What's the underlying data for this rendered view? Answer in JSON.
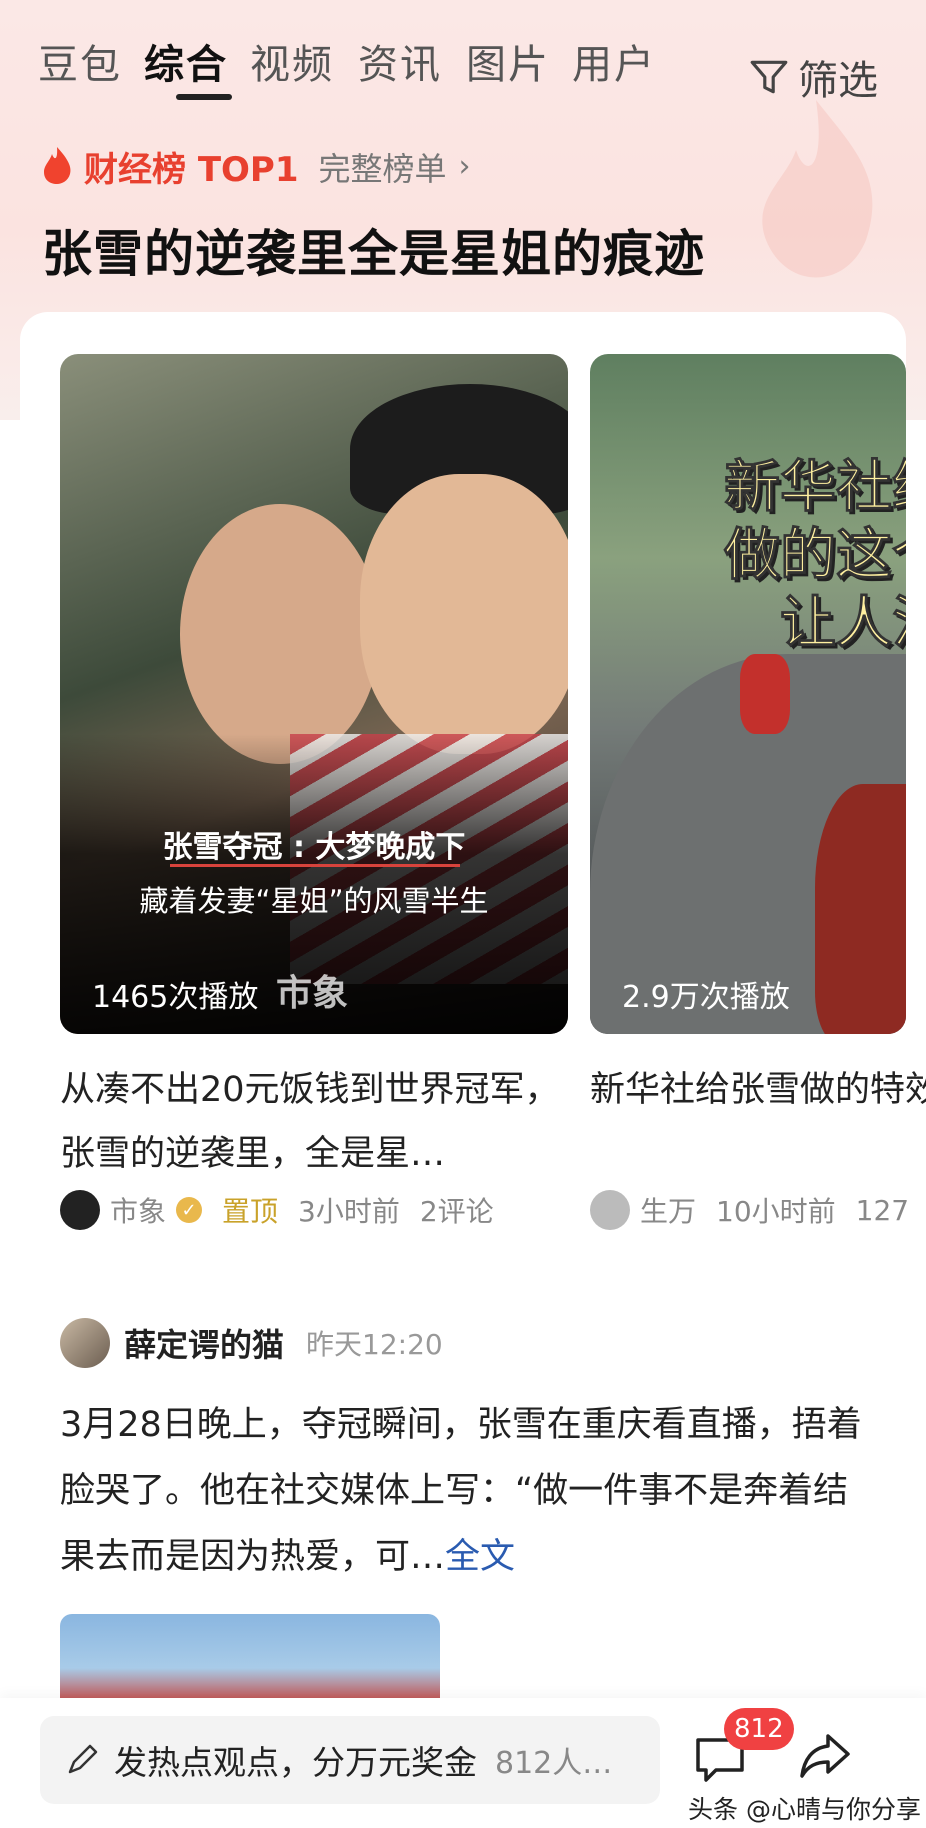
{
  "tabs": {
    "items": [
      "豆包",
      "综合",
      "视频",
      "资讯",
      "图片",
      "用户"
    ],
    "active": "综合",
    "filter_label": "筛选"
  },
  "hot": {
    "rank_label": "财经榜 TOP1",
    "full_list_label": "完整榜单",
    "headline": "张雪的逆袭里全是星姐的痕迹"
  },
  "videos": [
    {
      "caption_line1": "张雪夺冠 : 大梦晚成下",
      "caption_line2": "藏着发妻“星姐”的风雪半生",
      "plays": "1465次播放",
      "watermark": "市象",
      "title": "从凑不出20元饭钱到世界冠军，张雪的逆袭里，全是星…",
      "source": "市象",
      "pinned": "置顶",
      "time": "3小时前",
      "comments": "2评论"
    },
    {
      "overlay_title": "新华社给\n做的这个\n让人泪",
      "plays": "2.9万次播放",
      "title": "新华社给张雪做的特效让人类泪了了",
      "source": "生万",
      "time": "10小时前",
      "extra": "127"
    }
  ],
  "post": {
    "author": "薛定谔的猫",
    "time": "昨天12:20",
    "body": "3月28日晚上，夺冠瞬间，张雪在重庆看直播，捂着脸哭了。他在社交媒体上写：“做一件事不是奔着结果去而是因为热爱，可…",
    "more_label": "全文"
  },
  "bottom": {
    "compose_label": "发热点观点，分万元奖金",
    "compose_count": "812人…",
    "comment_badge": "812",
    "watermark": "头条 @心晴与你分享"
  },
  "colors": {
    "accent_red": "#e8402f",
    "link_blue": "#2a5bb0",
    "pin_gold": "#c9a22a"
  }
}
